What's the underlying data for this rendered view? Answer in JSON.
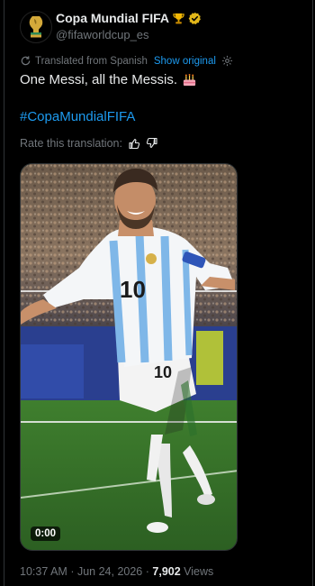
{
  "account": {
    "display_name": "Copa Mundial FIFA",
    "handle": "@fifaworldcup_es",
    "badges": [
      "trophy-icon",
      "verified-badge-icon"
    ]
  },
  "translation": {
    "translated_from": "Translated from Spanish",
    "show_original": "Show original"
  },
  "tweet": {
    "text": "One Messi, all the Messis.",
    "emoji": "birthday-cake-icon",
    "hashtag": "#CopaMundialFIFA"
  },
  "rate": {
    "label": "Rate this translation:"
  },
  "media": {
    "type": "video",
    "timecode": "0:00",
    "jersey_number": "10"
  },
  "meta": {
    "time": "10:37 AM",
    "separator": "·",
    "date": "Jun 24, 2026",
    "views_count": "7,902",
    "views_label": "Views"
  },
  "colors": {
    "background": "#000000",
    "text_primary": "#e7e9ea",
    "text_secondary": "#71767b",
    "link": "#1d9bf0",
    "verified_badge": "#e2b719"
  }
}
